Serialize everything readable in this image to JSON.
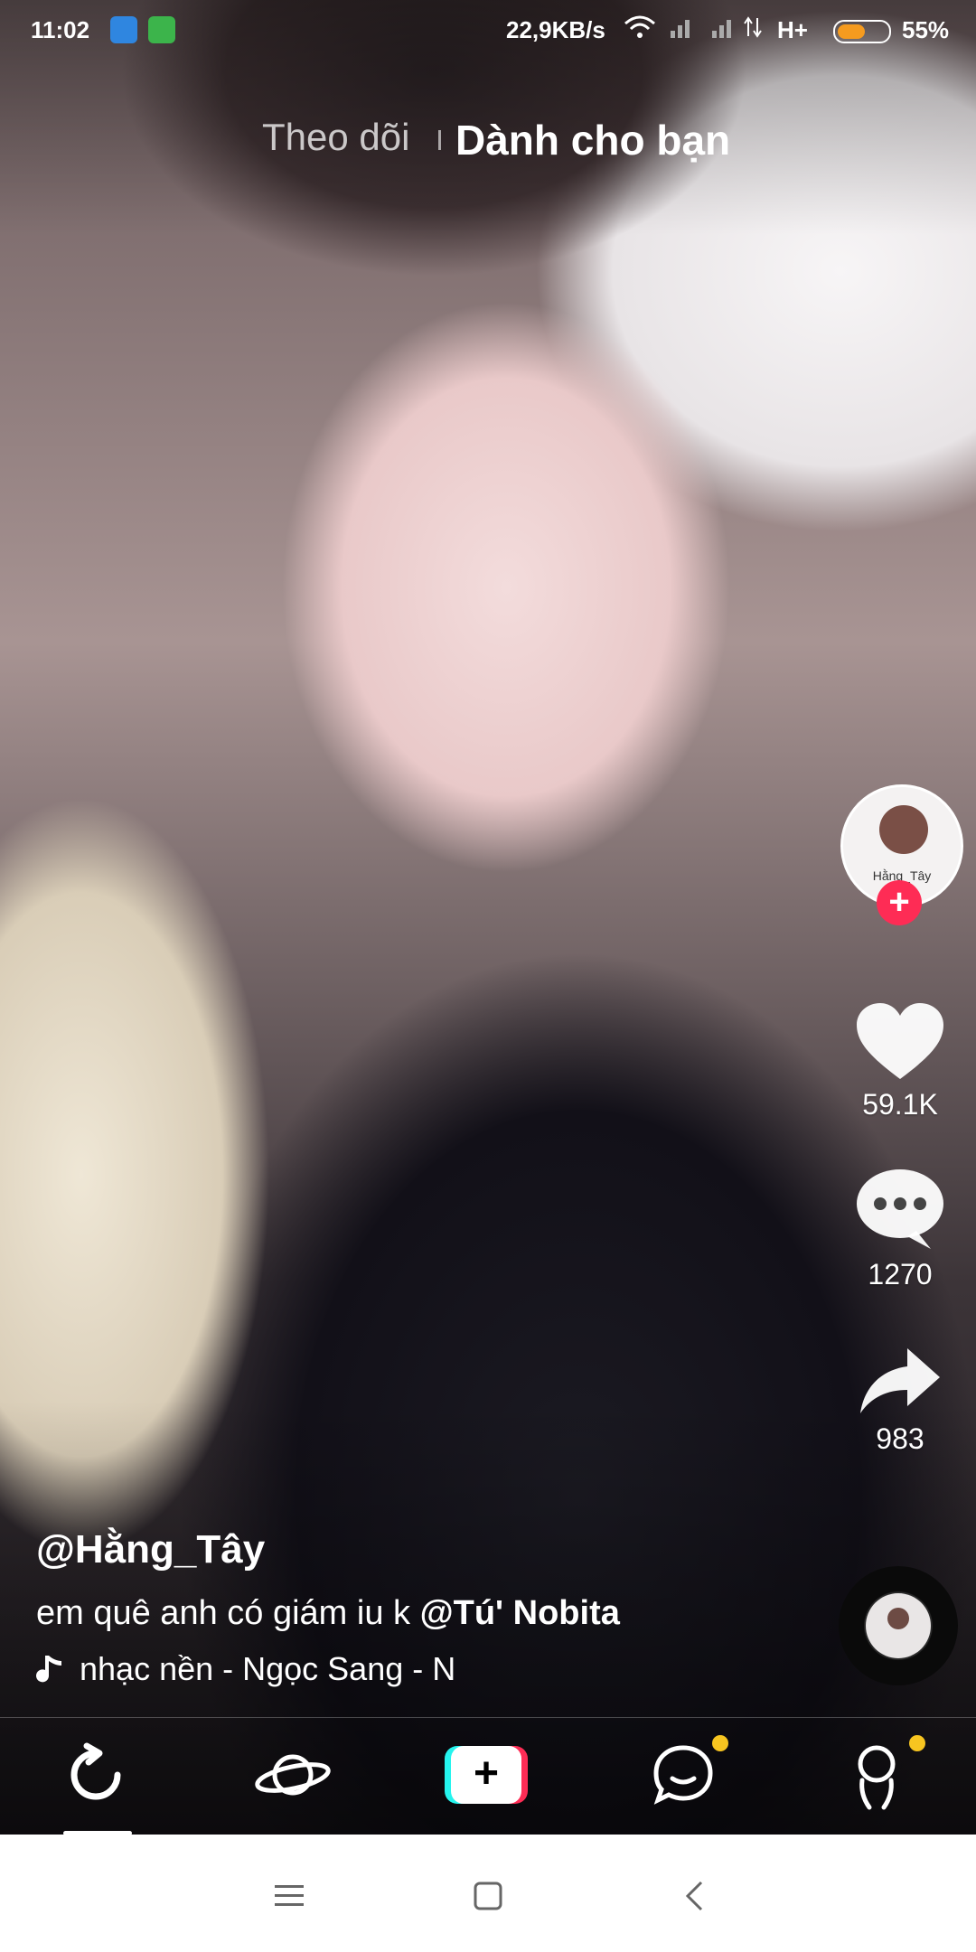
{
  "status_bar": {
    "time": "11:02",
    "network_speed": "22,9KB/s",
    "network_type": "H+",
    "battery_percent": "55%",
    "battery_level": 0.55,
    "icons": [
      "app-notification-icon",
      "cat-app-icon",
      "wifi-icon",
      "signal-icon",
      "battery-icon"
    ]
  },
  "top_tabs": {
    "following": "Theo dõi",
    "for_you": "Dành cho bạn",
    "active": "for_you"
  },
  "actions": {
    "avatar_label": "Hằng_Tây",
    "like_count": "59.1K",
    "comment_count": "1270",
    "share_count": "983"
  },
  "post": {
    "author": "@Hằng_Tây",
    "caption_text": "em quê anh có giám iu k ",
    "caption_mention": "@Tú' Nobita",
    "music": "nhạc nền - Ngọc Sang - N"
  },
  "bottom_nav": {
    "items": [
      "home-icon",
      "discover-icon",
      "create-icon",
      "inbox-icon",
      "profile-icon"
    ],
    "active": "home",
    "badge_color": "#f7c520"
  },
  "colors": {
    "accent_red": "#fe2c55",
    "accent_cyan": "#25f4ee",
    "battery_fill": "#f59b1f"
  }
}
